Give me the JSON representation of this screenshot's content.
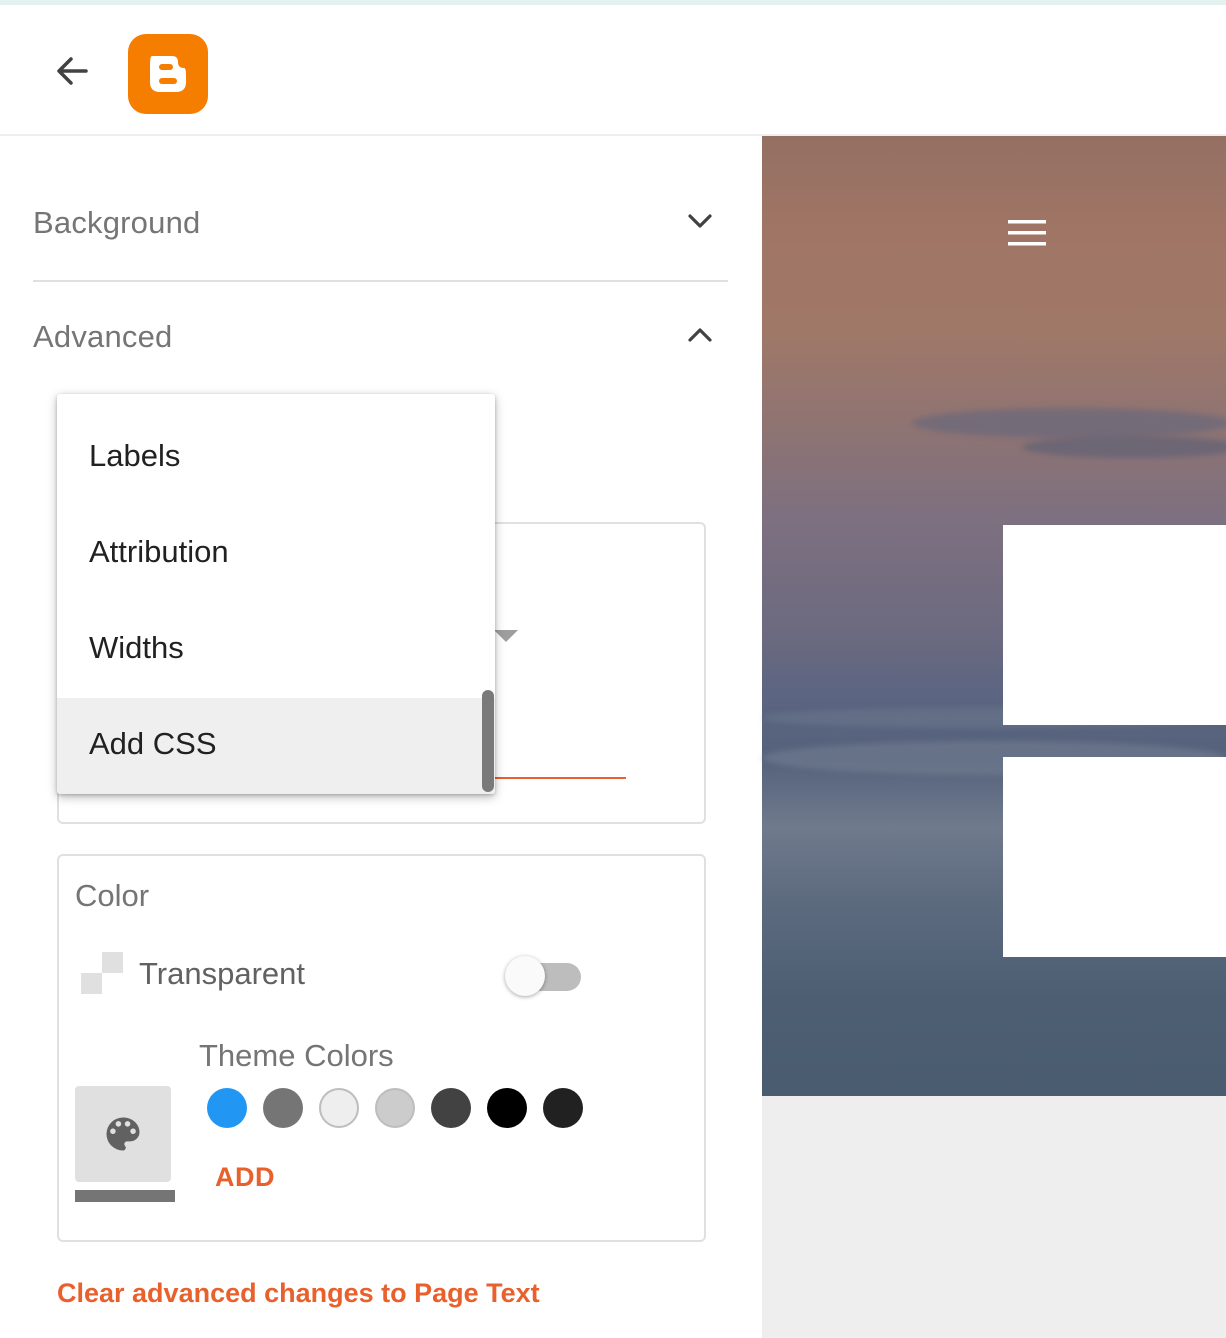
{
  "header": {
    "back_icon": "arrow-left-icon",
    "logo_icon": "blogger-logo-icon",
    "logo_color": "#f57d00"
  },
  "sections": {
    "background": {
      "label": "Background",
      "icon": "chevron-down-icon"
    },
    "advanced": {
      "label": "Advanced",
      "icon": "chevron-up-icon"
    }
  },
  "dropdown_menu": {
    "items": [
      {
        "label": "Labels",
        "selected": false
      },
      {
        "label": "Attribution",
        "selected": false
      },
      {
        "label": "Widths",
        "selected": false
      },
      {
        "label": "Add CSS",
        "selected": true
      }
    ]
  },
  "color_card": {
    "title": "Color",
    "transparent_label": "Transparent",
    "transparent_on": false,
    "theme_colors_label": "Theme Colors",
    "palette_icon": "palette-icon",
    "swatches": [
      "#2196f3",
      "#757575",
      "#eeeeee",
      "#cccccc",
      "#424242",
      "#000000",
      "#212121"
    ],
    "add_label": "ADD"
  },
  "footer": {
    "clear_link": "Clear advanced changes to Page Text"
  },
  "preview": {
    "menu_icon": "hamburger-menu-icon"
  },
  "colors": {
    "accent": "#e8602c",
    "muted_text": "#757575"
  }
}
